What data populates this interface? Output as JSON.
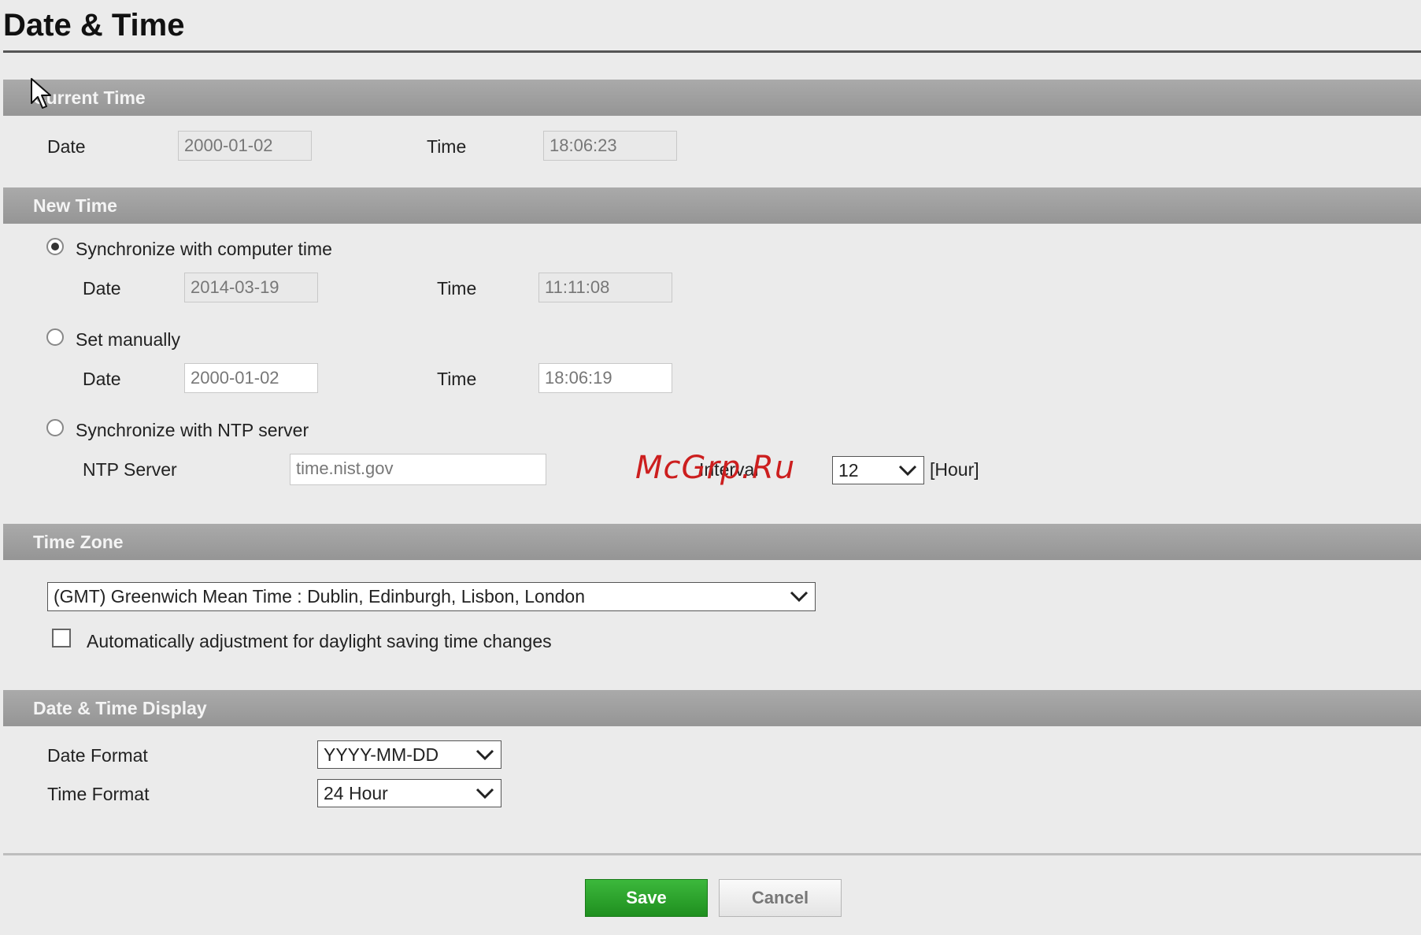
{
  "page": {
    "title": "Date & Time"
  },
  "current_time": {
    "section_title": "Current Time",
    "date_label": "Date",
    "date_value": "2000-01-02",
    "time_label": "Time",
    "time_value": "18:06:23"
  },
  "new_time": {
    "section_title": "New Time",
    "sync_computer": {
      "label": "Synchronize with computer time",
      "selected": true,
      "date_label": "Date",
      "date_value": "2014-03-19",
      "time_label": "Time",
      "time_value": "11:11:08"
    },
    "manual": {
      "label": "Set manually",
      "selected": false,
      "date_label": "Date",
      "date_value": "2000-01-02",
      "time_label": "Time",
      "time_value": "18:06:19"
    },
    "ntp": {
      "label": "Synchronize with NTP server",
      "selected": false,
      "server_label": "NTP Server",
      "server_value": "time.nist.gov",
      "interval_label": "Interval",
      "interval_value": "12",
      "interval_unit": "[Hour]"
    }
  },
  "time_zone": {
    "section_title": "Time Zone",
    "selected": "(GMT) Greenwich Mean Time : Dublin, Edinburgh, Lisbon, London",
    "dst_label": "Automatically adjustment for daylight saving time changes",
    "dst_checked": false
  },
  "display": {
    "section_title": "Date & Time Display",
    "date_format_label": "Date Format",
    "date_format_value": "YYYY-MM-DD",
    "time_format_label": "Time Format",
    "time_format_value": "24 Hour"
  },
  "actions": {
    "save_label": "Save",
    "cancel_label": "Cancel"
  },
  "watermark": {
    "text": "McGrp.Ru"
  },
  "colors": {
    "section_bar": "#a3a3a3",
    "save_green": "#2ea52e",
    "watermark_red": "#cc1e1e"
  }
}
